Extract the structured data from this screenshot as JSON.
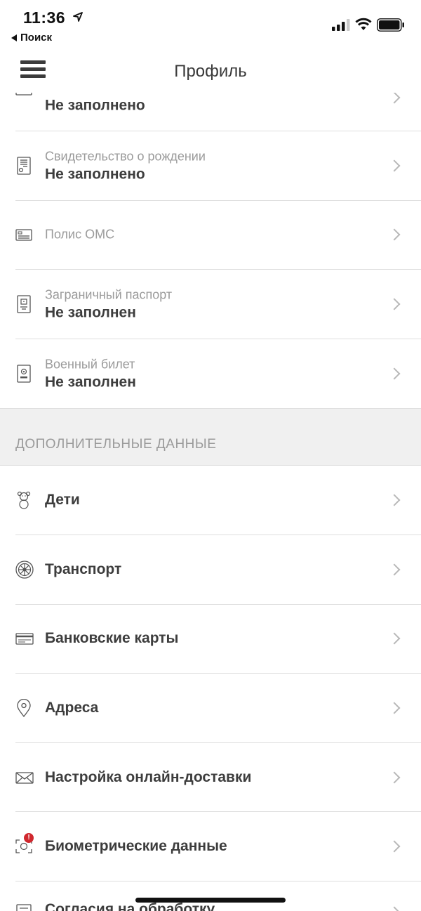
{
  "status_bar": {
    "time": "11:36",
    "back_app": "Поиск"
  },
  "nav": {
    "title": "Профиль"
  },
  "documents": [
    {
      "icon": "id-card-icon",
      "subtitle": "",
      "value": "Не заполнено"
    },
    {
      "icon": "certificate-icon",
      "subtitle": "Свидетельство о рождении",
      "value": "Не заполнено"
    },
    {
      "icon": "insurance-card-icon",
      "subtitle": "Полис ОМС",
      "value": ""
    },
    {
      "icon": "passport-icon",
      "subtitle": "Заграничный паспорт",
      "value": "Не заполнен"
    },
    {
      "icon": "military-id-icon",
      "subtitle": "Военный билет",
      "value": "Не заполнен"
    }
  ],
  "section": {
    "title": "ДОПОЛНИТЕЛЬНЫЕ ДАННЫЕ"
  },
  "additional": [
    {
      "icon": "teddy-bear-icon",
      "label": "Дети"
    },
    {
      "icon": "wheel-icon",
      "label": "Транспорт"
    },
    {
      "icon": "bank-card-icon",
      "label": "Банковские карты"
    },
    {
      "icon": "location-pin-icon",
      "label": "Адреса"
    },
    {
      "icon": "envelope-icon",
      "label": "Настройка онлайн-доставки"
    },
    {
      "icon": "biometric-icon",
      "label": "Биометрические данные",
      "badge": "!"
    },
    {
      "icon": "consent-icon",
      "label": "Согласия на обработку"
    }
  ],
  "colors": {
    "badge": "#d0282e",
    "section_bg": "#f0f0f0"
  }
}
